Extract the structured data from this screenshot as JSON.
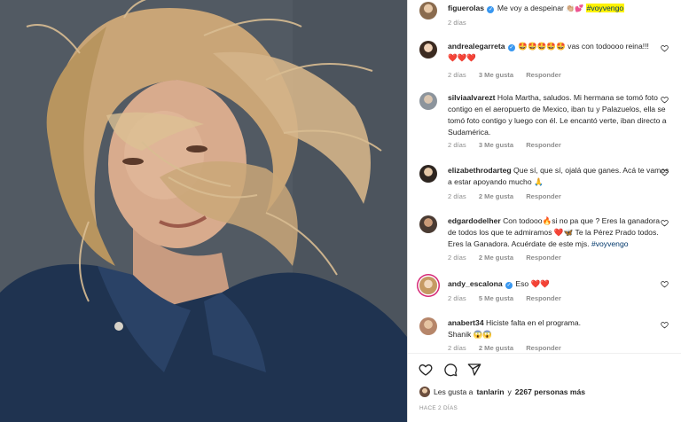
{
  "post": {
    "author": "figuerolas",
    "caption": "Me voy a despeinar",
    "caption_emoji": "👏🏼💕",
    "hashtag": "#voyvengo",
    "time": "2 días"
  },
  "comments": [
    {
      "user": "andrealegarreta",
      "verified": true,
      "text": "🤩🤩🤩🤩🤩 vas con todoooo reina!!!",
      "text2": "❤️❤️❤️",
      "time": "2 días",
      "likes": "3 Me gusta",
      "reply": "Responder"
    },
    {
      "user": "silviaalvarezt",
      "verified": false,
      "text": "Hola Martha, saludos. Mi hermana se tomó foto contigo en el aeropuerto de Mexico, iban tu y Palazuelos, ella se tomó foto contigo y luego con él. Le encantó verte, iban directo a Sudamérica.",
      "time": "2 días",
      "likes": "3 Me gusta",
      "reply": "Responder"
    },
    {
      "user": "elizabethrodarteg",
      "verified": false,
      "text": "Que sí, que sí, ojalá que ganes. Acá te vamos a estar apoyando mucho 🙏",
      "time": "2 días",
      "likes": "2 Me gusta",
      "reply": "Responder"
    },
    {
      "user": "edgardodelher",
      "verified": false,
      "text": "Con todooo🔥si no pa que ? Eres la ganadora de todos los que te admiramos ❤️🦋 Te la Pérez Prado todos. Eres la Ganadora. Acuérdate de este mjs.",
      "hashtag": "#voyvengo",
      "time": "2 días",
      "likes": "2 Me gusta",
      "reply": "Responder"
    },
    {
      "user": "andy_escalona",
      "verified": true,
      "text": "Eso ❤️❤️",
      "time": "2 días",
      "likes": "5 Me gusta",
      "reply": "Responder"
    },
    {
      "user": "anabert34",
      "verified": false,
      "text": "Hiciste falta en el programa.",
      "text2": "Shanik 😱😱",
      "time": "2 días",
      "likes": "2 Me gusta",
      "reply": "Responder"
    }
  ],
  "footer": {
    "likes_prefix": "Les gusta a",
    "likes_user": "tanlarin",
    "likes_mid": "y",
    "likes_count": "2267 personas más",
    "ago": "HACE 2 DÍAS"
  },
  "icons": [
    "heart-icon",
    "comment-icon",
    "share-icon",
    "verified-icon"
  ],
  "colors": {
    "accent": "#3897f0",
    "highlight": "#fff200",
    "link": "#00376b",
    "muted": "#8e8e8e",
    "heart": "#ed4956"
  }
}
